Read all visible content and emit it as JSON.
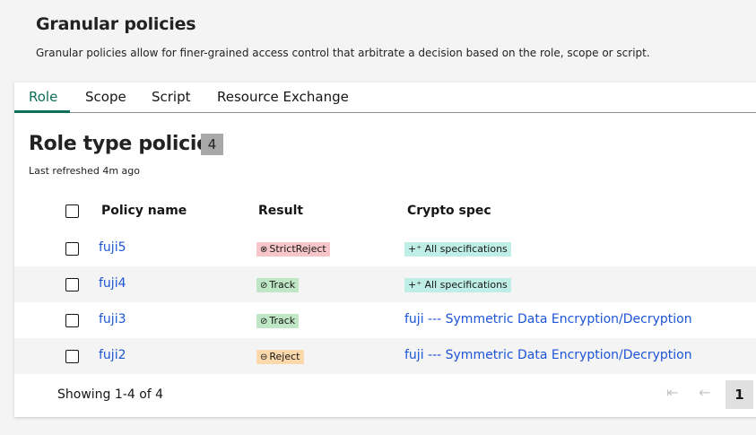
{
  "header": {
    "title": "Granular policies",
    "description": "Granular policies allow for finer-grained access control that arbitrate a decision based on the role, scope or script."
  },
  "tabs": [
    {
      "label": "Role",
      "active": true
    },
    {
      "label": "Scope",
      "active": false
    },
    {
      "label": "Script",
      "active": false
    },
    {
      "label": "Resource Exchange",
      "active": false
    }
  ],
  "section": {
    "title": "Role type policies",
    "count": "4",
    "last_refreshed": "Last refreshed 4m ago"
  },
  "table": {
    "columns": [
      "Policy name",
      "Result",
      "Crypto spec"
    ],
    "rows": [
      {
        "name": "fuji5",
        "result": "StrictReject",
        "result_icon": "x-circle-icon",
        "result_color": "#f7c6ca",
        "spec": "All specifications",
        "spec_is_tag": true
      },
      {
        "name": "fuji4",
        "result": "Track",
        "result_icon": "check-circle-icon",
        "result_color": "#bfe6c5",
        "spec": "All specifications",
        "spec_is_tag": true
      },
      {
        "name": "fuji3",
        "result": "Track",
        "result_icon": "check-circle-icon",
        "result_color": "#bfe6c5",
        "spec": "fuji --- Symmetric Data Encryption/Decryption",
        "spec_is_tag": false
      },
      {
        "name": "fuji2",
        "result": "Reject",
        "result_icon": "minus-circle-icon",
        "result_color": "#fcd8ad",
        "spec": "fuji --- Symmetric Data Encryption/Decryption",
        "spec_is_tag": false
      }
    ]
  },
  "footer": {
    "showing": "Showing 1-4 of 4",
    "current_page": "1",
    "first_icon": "⇤",
    "prev_icon": "←"
  },
  "colors": {
    "accent": "#0f6e55",
    "link": "#1d55d6"
  }
}
